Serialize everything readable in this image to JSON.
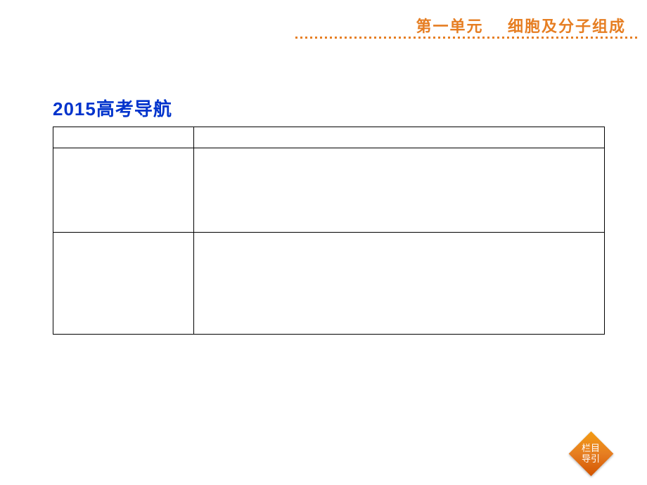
{
  "header": {
    "unit_label": "第一单元",
    "unit_title": "细胞及分子组成"
  },
  "title": "2015高考导航",
  "nav_badge": {
    "line1": "栏目",
    "line2": "导引"
  },
  "table": {
    "rows": [
      {
        "col1": "",
        "col2": ""
      },
      {
        "col1": "",
        "col2": ""
      },
      {
        "col1": "",
        "col2": ""
      }
    ]
  }
}
